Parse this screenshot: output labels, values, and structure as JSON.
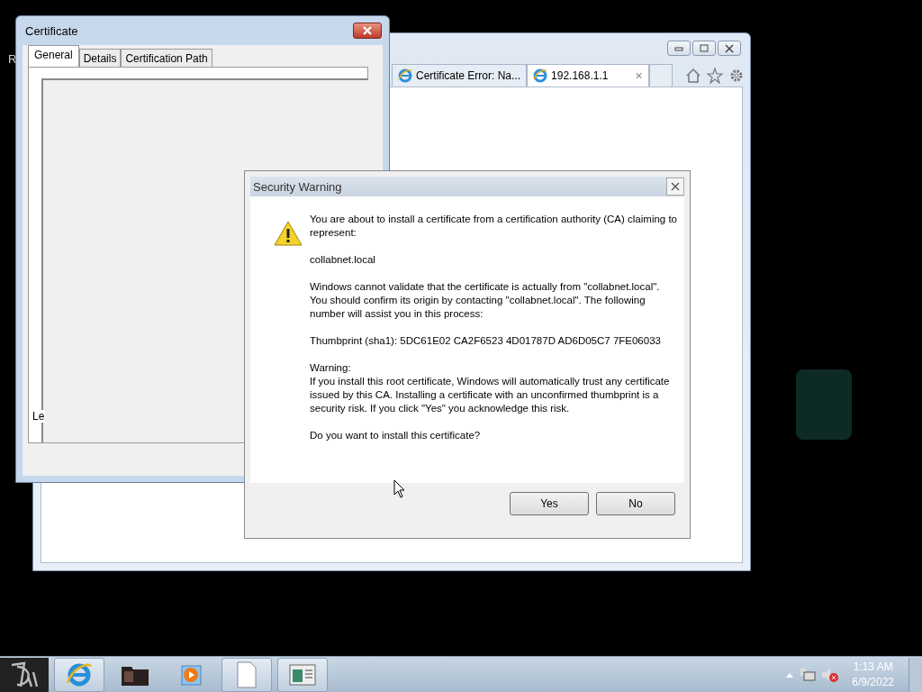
{
  "desktop": {
    "cut_text": "R"
  },
  "browser": {
    "tabs": [
      {
        "label": "Certificate Error: Na...",
        "selected": false
      },
      {
        "label": "192.168.1.1",
        "selected": true
      }
    ],
    "tab_close": "×"
  },
  "certificate_dialog": {
    "title": "Certificate",
    "tabs": [
      {
        "label": "General",
        "selected": true
      },
      {
        "label": "Details",
        "selected": false
      },
      {
        "label": "Certification Path",
        "selected": false
      }
    ],
    "cut_text": "Le"
  },
  "security_warning": {
    "title": "Security Warning",
    "paragraphs": [
      "You are about to install a certificate from a certification authority (CA) claiming to represent:",
      "collabnet.local",
      "Windows cannot validate that the certificate is actually from \"collabnet.local\". You should confirm its origin by contacting \"collabnet.local\". The following number will assist you in this process:",
      "Thumbprint (sha1): 5DC61E02 CA2F6523 4D01787D AD6D05C7 7FE06033",
      "Warning:\nIf you install this root certificate, Windows will automatically trust any certificate issued by this CA. Installing a certificate with an unconfirmed thumbprint is a security risk. If you click \"Yes\" you acknowledge this risk.",
      "Do you want to install this certificate?"
    ],
    "buttons": [
      "Yes",
      "No"
    ]
  },
  "taskbar": {
    "time": "1:13 AM",
    "date": "6/9/2022"
  }
}
